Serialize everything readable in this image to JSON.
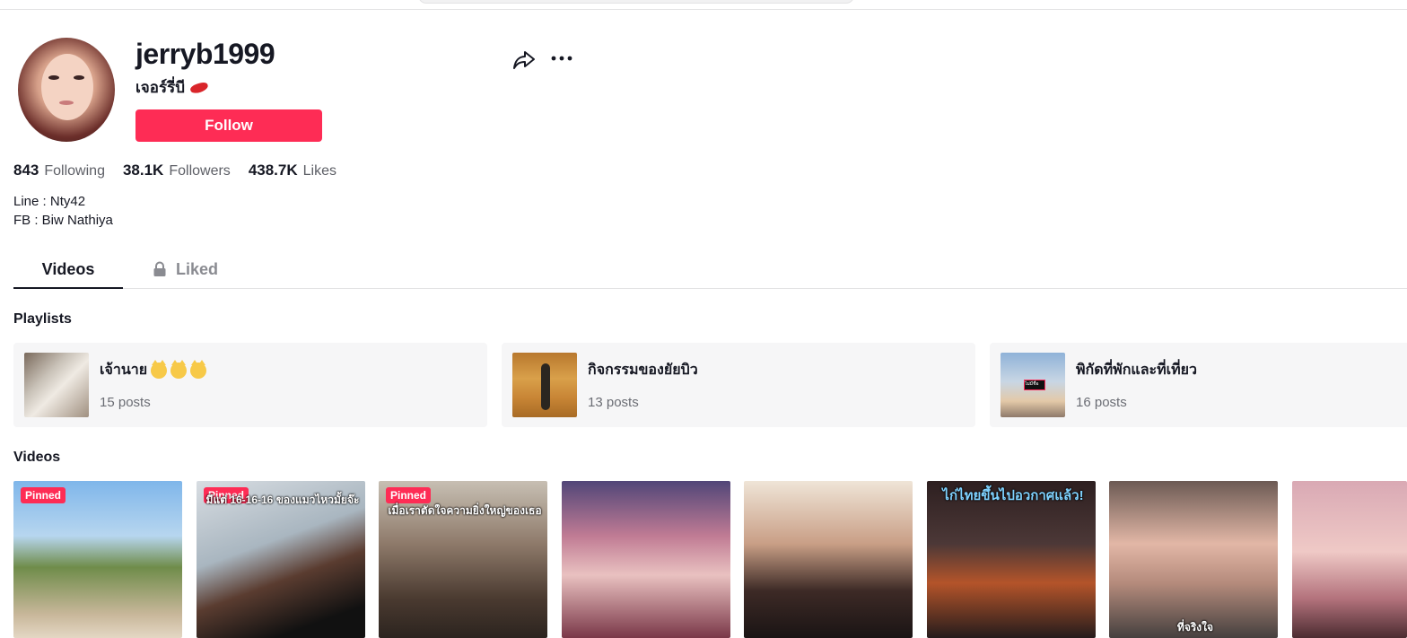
{
  "profile": {
    "username": "jerryb1999",
    "nickname": "เจอร์รี่บี",
    "follow_label": "Follow"
  },
  "stats": [
    {
      "value": "843",
      "label": "Following"
    },
    {
      "value": "38.1K",
      "label": "Followers"
    },
    {
      "value": "438.7K",
      "label": "Likes"
    }
  ],
  "bio": [
    "Line : Nty42",
    "FB : Biw Nathiya"
  ],
  "tabs": [
    {
      "label": "Videos",
      "active": true
    },
    {
      "label": "Liked",
      "locked": true
    }
  ],
  "sections": {
    "playlists": "Playlists",
    "videos": "Videos"
  },
  "playlists": [
    {
      "title": "เจ้านาย",
      "count": "15 posts"
    },
    {
      "title": "กิจกรรมของยัยบิว",
      "count": "13 posts"
    },
    {
      "title": "พิกัดที่พักและที่เที่ยว",
      "count": "16 posts"
    }
  ],
  "videos": [
    {
      "pinned": "Pinned",
      "caption": ""
    },
    {
      "pinned": "Pinned",
      "caption": "มีแต่ 16-16-16 ของแมวไหวมั้ยจ๊ะ"
    },
    {
      "pinned": "Pinned",
      "caption": "เมื่อเราตัดใจความยิ่งใหญ่ของเธอ"
    },
    {
      "pinned": "",
      "caption": ""
    },
    {
      "pinned": "",
      "caption": ""
    },
    {
      "pinned": "",
      "caption": "ไก่ไทยขึ้นไปอวกาศแล้ว!"
    },
    {
      "pinned": "",
      "caption": "ที่จริงใจ"
    },
    {
      "pinned": "",
      "caption": ""
    }
  ],
  "colors": {
    "accent": "#fe2c55",
    "text": "#161823",
    "muted": "#5d5f66",
    "card": "#f6f6f7"
  }
}
